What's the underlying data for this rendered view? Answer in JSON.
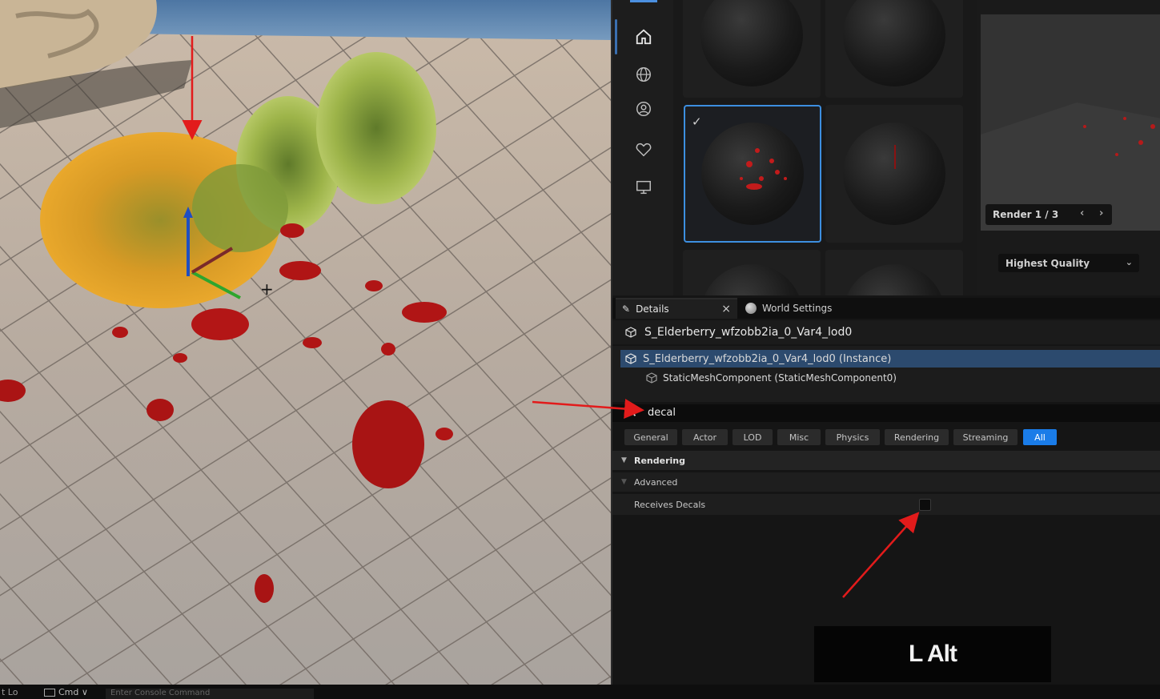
{
  "preview": {
    "render_label": "Render 1 / 3",
    "prev_icon": "chevron-left-icon",
    "next_icon": "chevron-right-icon",
    "quality_value": "Highest Quality"
  },
  "rail": {
    "icons": [
      "home-icon",
      "globe-icon",
      "user-icon",
      "heart-icon",
      "monitor-icon"
    ]
  },
  "details": {
    "tabs": [
      {
        "label": "Details",
        "icon": "pencil-icon"
      },
      {
        "label": "World Settings",
        "icon": "globe-icon"
      }
    ],
    "close_glyph": "×",
    "object_name": "S_Elderberry_wfzobb2ia_0_Var4_lod0",
    "components": [
      "S_Elderberry_wfzobb2ia_0_Var4_lod0 (Instance)",
      "StaticMeshComponent (StaticMeshComponent0)"
    ],
    "search_value": "decal",
    "filters": [
      "General",
      "Actor",
      "LOD",
      "Misc",
      "Physics",
      "Rendering",
      "Streaming",
      "All"
    ],
    "active_filter": "All",
    "categories": [
      "Rendering",
      "Advanced"
    ],
    "property": {
      "label": "Receives Decals",
      "checked": false
    }
  },
  "key_overlay": "L Alt",
  "statusbar": {
    "log_label": "t Lo",
    "cmd_label": "Cmd ∨",
    "console_placeholder": "Enter Console Command"
  },
  "colors": {
    "accent": "#1a7ce8",
    "selection": "#2c4a6e",
    "annotation": "#e21b1b"
  }
}
